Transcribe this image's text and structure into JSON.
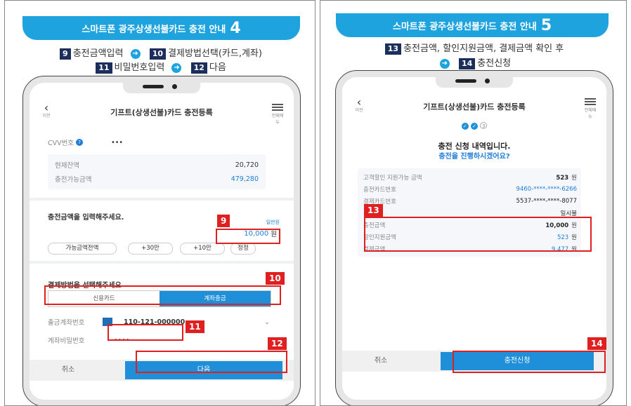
{
  "left": {
    "banner": {
      "title": "스마트폰 광주상생선불카드 충전 안내",
      "num": "4"
    },
    "steps_line1": {
      "b9": "9",
      "t9": "충전금액입력",
      "b10": "10",
      "t10": "결제방법선택(카드,계좌)"
    },
    "steps_line2": {
      "b11": "11",
      "t11": "비밀번호입력",
      "b12": "12",
      "t12": "다음"
    },
    "screen": {
      "back_label": "이전",
      "title": "기프트(상생선불)카드 충전등록",
      "menu_label": "전체메뉴",
      "cvv_label": "CVV번호",
      "cvv_value": "•••",
      "balance_label": "현재잔액",
      "balance_value": "20,720",
      "chargeable_label": "충전가능금액",
      "chargeable_value": "479,280",
      "amount_heading": "충전금액을 입력해주세요.",
      "amount_unit_hint": "일만원",
      "amount_value": "10,000",
      "amount_unit": "원",
      "chip_all": "가능금액전액",
      "chip_30": "+30만",
      "chip_10": "+10만",
      "chip_reset": "정정",
      "pay_heading": "결제방법을 선택해주세요",
      "pay_card": "신용카드",
      "pay_account": "계좌출금",
      "account_label": "출금계좌번호",
      "account_value": "110-121-000000",
      "pw_label": "계좌비밀번호",
      "pw_value": "••••",
      "cancel": "취소",
      "next": "다음"
    },
    "labels": {
      "l9": "9",
      "l10": "10",
      "l11": "11",
      "l12": "12"
    }
  },
  "right": {
    "banner": {
      "title": "스마트폰 광주상생선불카드 충전 안내",
      "num": "5"
    },
    "steps_line1": {
      "b13": "13",
      "t13": "충전금액, 할인지원금액, 결제금액 확인 후"
    },
    "steps_line2": {
      "b14": "14",
      "t14": "충전신청"
    },
    "screen": {
      "back_label": "이전",
      "title": "기프트(상생선불)카드 충전등록",
      "menu_label": "전체메뉴",
      "step3": "3",
      "confirm_title": "충전 신청 내역입니다.",
      "confirm_question": "충전을 진행하시겠어요?",
      "rows": [
        {
          "label": "고객할인 지원가능 금액",
          "value": "523",
          "unit": "원",
          "style": "dark"
        },
        {
          "label": "충전카드번호",
          "value": "9460-****-****-6266",
          "unit": "",
          "style": "blue"
        },
        {
          "label": "결제카드번호",
          "value": "5537-****-****-8077",
          "unit": "",
          "style": "dark"
        },
        {
          "label": "부가혜",
          "value": "일시불",
          "unit": "",
          "style": "dark"
        },
        {
          "label": "충전금액",
          "value": "10,000",
          "unit": "원",
          "style": "bold"
        },
        {
          "label": "할인지원금액",
          "value": "523",
          "unit": "원",
          "style": "blue"
        },
        {
          "label": "결제금액",
          "value": "9,477",
          "unit": "원",
          "style": "blue"
        }
      ],
      "cancel": "취소",
      "apply": "충전신청"
    },
    "labels": {
      "l13": "13",
      "l14": "14"
    }
  },
  "colors": {
    "accent": "#1fa3de",
    "navy": "#1c2f5c",
    "red": "#e02020",
    "button_blue": "#1e8fd8"
  }
}
